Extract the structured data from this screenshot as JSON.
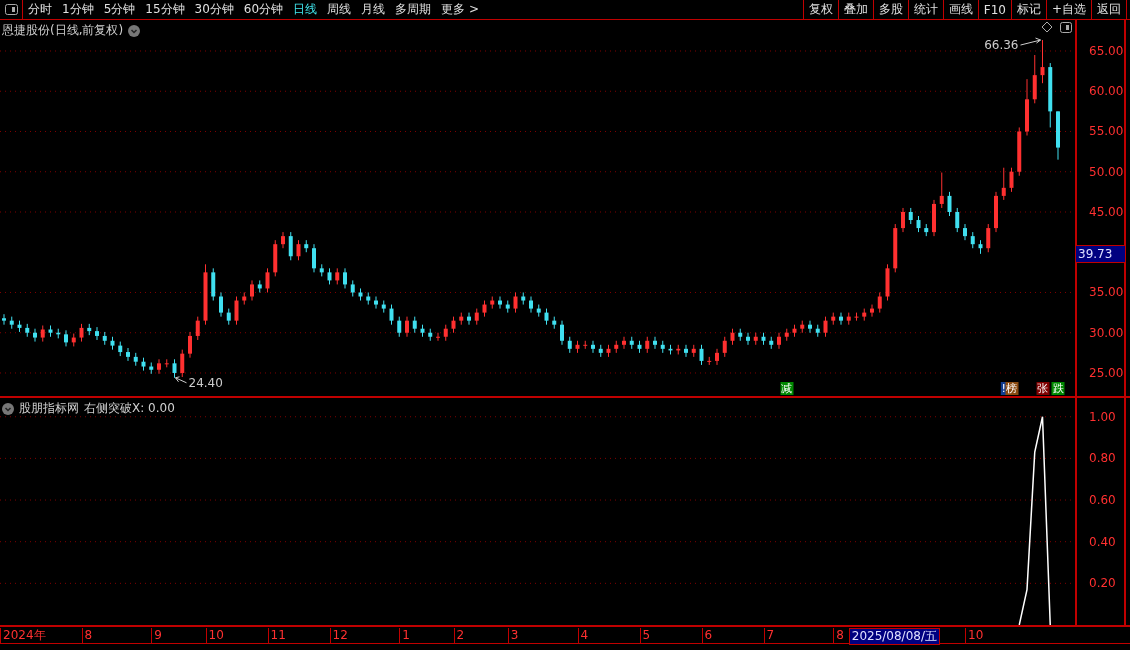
{
  "toolbar": {
    "periods": [
      {
        "label": "分时",
        "selected": false
      },
      {
        "label": "1分钟",
        "selected": false
      },
      {
        "label": "5分钟",
        "selected": false
      },
      {
        "label": "15分钟",
        "selected": false
      },
      {
        "label": "30分钟",
        "selected": false
      },
      {
        "label": "60分钟",
        "selected": false
      },
      {
        "label": "日线",
        "selected": true
      },
      {
        "label": "周线",
        "selected": false
      },
      {
        "label": "月线",
        "selected": false
      },
      {
        "label": "多周期",
        "selected": false
      },
      {
        "label": "更多 >",
        "selected": false
      }
    ],
    "buttons": [
      "复权",
      "叠加",
      "多股",
      "统计",
      "画线",
      "F10",
      "标记",
      "+自选",
      "返回"
    ]
  },
  "main_pane": {
    "title": "恩捷股份(日线,前复权)",
    "high_label": "66.36",
    "low_label": "24.40",
    "current_price": "39.73",
    "chart_data": {
      "type": "candlestick",
      "grid": true,
      "ylim": [
        22.14,
        68.85
      ],
      "yticks": [
        {
          "value": 25,
          "label": "25.00"
        },
        {
          "value": 30,
          "label": "30.00"
        },
        {
          "value": 35,
          "label": "35.00"
        },
        {
          "value": 45,
          "label": "45.00"
        },
        {
          "value": 50,
          "label": "50.00"
        },
        {
          "value": 55,
          "label": "55.00"
        },
        {
          "value": 60,
          "label": "60.00"
        },
        {
          "value": 65,
          "label": "65.00"
        }
      ],
      "ohlc": [
        [
          31.8,
          32.3,
          31,
          31.5
        ],
        [
          31.5,
          32,
          30.5,
          31
        ],
        [
          31,
          31.5,
          30.1,
          30.6
        ],
        [
          30.6,
          31.1,
          29.5,
          30
        ],
        [
          30,
          30.5,
          28.9,
          29.4
        ],
        [
          29.4,
          30.9,
          28.9,
          30.4
        ],
        [
          30.4,
          30.9,
          29.5,
          30
        ],
        [
          30,
          30.5,
          29.3,
          29.8
        ],
        [
          29.8,
          30.3,
          28.3,
          28.8
        ],
        [
          28.8,
          29.9,
          28.3,
          29.4
        ],
        [
          29.4,
          31.1,
          28.9,
          30.6
        ],
        [
          30.6,
          31.1,
          29.7,
          30.2
        ],
        [
          30.2,
          30.7,
          29.1,
          29.6
        ],
        [
          29.6,
          30.1,
          28.5,
          29
        ],
        [
          29,
          29.5,
          27.9,
          28.4
        ],
        [
          28.4,
          28.9,
          27.1,
          27.6
        ],
        [
          27.6,
          28.1,
          26.5,
          27
        ],
        [
          27,
          27.5,
          25.9,
          26.4
        ],
        [
          26.4,
          26.9,
          25.3,
          25.8
        ],
        [
          25.8,
          26.3,
          24.9,
          25.4
        ],
        [
          25.4,
          26.7,
          24.9,
          26.2
        ],
        [
          26.2,
          26.7,
          25.7,
          26.2
        ],
        [
          26.2,
          26.7,
          24.4,
          25
        ],
        [
          25,
          27.9,
          24.5,
          27.4
        ],
        [
          27.4,
          30.1,
          26.9,
          29.6
        ],
        [
          29.6,
          32,
          29.1,
          31.5
        ],
        [
          31.5,
          38.5,
          31,
          37.5
        ],
        [
          37.5,
          38,
          34,
          34.5
        ],
        [
          34.5,
          35,
          32,
          32.5
        ],
        [
          32.5,
          33,
          31,
          31.5
        ],
        [
          31.5,
          34.5,
          31,
          34
        ],
        [
          34,
          35,
          33.5,
          34.5
        ],
        [
          34.5,
          36.5,
          34,
          36
        ],
        [
          36,
          36.5,
          35,
          35.5
        ],
        [
          35.5,
          38,
          35,
          37.5
        ],
        [
          37.5,
          41.5,
          37,
          41
        ],
        [
          41,
          42.5,
          40.5,
          42
        ],
        [
          42,
          42.5,
          39,
          39.5
        ],
        [
          39.5,
          41.5,
          39,
          41
        ],
        [
          41,
          41.5,
          40,
          40.5
        ],
        [
          40.5,
          41,
          37.5,
          38
        ],
        [
          38,
          38.5,
          37,
          37.5
        ],
        [
          37.5,
          38,
          36,
          36.5
        ],
        [
          36.5,
          38,
          36,
          37.5
        ],
        [
          37.5,
          38,
          35.5,
          36
        ],
        [
          36,
          36.5,
          34.5,
          35
        ],
        [
          35,
          35.5,
          34,
          34.5
        ],
        [
          34.5,
          35,
          33.5,
          34
        ],
        [
          34,
          34.5,
          33,
          33.5
        ],
        [
          33.5,
          34,
          32.5,
          33
        ],
        [
          33,
          33.5,
          31,
          31.5
        ],
        [
          31.5,
          32,
          29.5,
          30
        ],
        [
          30,
          32,
          29.5,
          31.5
        ],
        [
          31.5,
          32,
          30,
          30.5
        ],
        [
          30.5,
          31,
          29.5,
          30
        ],
        [
          30,
          30.5,
          29,
          29.5
        ],
        [
          29.5,
          30,
          29,
          29.5
        ],
        [
          29.5,
          31,
          29,
          30.5
        ],
        [
          30.5,
          32,
          30,
          31.5
        ],
        [
          31.5,
          32.5,
          31,
          32
        ],
        [
          32,
          32.5,
          31,
          31.5
        ],
        [
          31.5,
          33,
          31,
          32.5
        ],
        [
          32.5,
          34,
          32,
          33.5
        ],
        [
          33.5,
          34.5,
          33,
          34
        ],
        [
          34,
          34.5,
          33,
          33.5
        ],
        [
          33.5,
          34,
          32.5,
          33
        ],
        [
          33,
          35,
          32.5,
          34.5
        ],
        [
          34.5,
          35,
          33.5,
          34
        ],
        [
          34,
          34.5,
          32.5,
          33
        ],
        [
          33,
          33.5,
          32,
          32.5
        ],
        [
          32.5,
          33,
          31,
          31.5
        ],
        [
          31.5,
          32,
          30.5,
          31
        ],
        [
          31,
          31.5,
          28.5,
          29
        ],
        [
          29,
          29.5,
          27.5,
          28
        ],
        [
          28,
          29,
          27.5,
          28.5
        ],
        [
          28.5,
          29,
          28,
          28.5
        ],
        [
          28.5,
          29,
          27.5,
          28
        ],
        [
          28,
          28.5,
          27,
          27.5
        ],
        [
          27.5,
          28.5,
          27,
          28
        ],
        [
          28,
          29,
          27.5,
          28.5
        ],
        [
          28.5,
          29.5,
          28,
          29
        ],
        [
          29,
          29.5,
          28,
          28.5
        ],
        [
          28.5,
          29,
          27.5,
          28
        ],
        [
          28,
          29.5,
          27.5,
          29
        ],
        [
          29,
          29.5,
          28,
          28.5
        ],
        [
          28.5,
          29,
          27.5,
          28
        ],
        [
          28,
          28.5,
          27.3,
          27.8
        ],
        [
          27.8,
          28.5,
          27.3,
          28
        ],
        [
          28,
          28.5,
          27,
          27.5
        ],
        [
          27.5,
          28.5,
          27,
          28
        ],
        [
          28,
          28.5,
          26,
          26.5
        ],
        [
          26.5,
          27,
          26,
          26.5
        ],
        [
          26.5,
          28,
          26,
          27.5
        ],
        [
          27.5,
          29.5,
          27,
          29
        ],
        [
          29,
          30.5,
          28.5,
          30
        ],
        [
          30,
          30.5,
          29,
          29.5
        ],
        [
          29.5,
          30,
          28.5,
          29
        ],
        [
          29,
          30,
          28.5,
          29.5
        ],
        [
          29.5,
          30,
          28.5,
          29
        ],
        [
          29,
          29.5,
          28,
          28.5
        ],
        [
          28.5,
          30,
          28,
          29.5
        ],
        [
          29.5,
          30.5,
          29,
          30
        ],
        [
          30,
          31,
          29.5,
          30.5
        ],
        [
          30.5,
          31.5,
          30,
          31
        ],
        [
          31,
          31.5,
          30,
          30.5
        ],
        [
          30.5,
          31,
          29.5,
          30
        ],
        [
          30,
          32,
          29.5,
          31.5
        ],
        [
          31.5,
          32.5,
          31,
          32
        ],
        [
          32,
          32.5,
          31,
          31.5
        ],
        [
          31.5,
          32.5,
          31,
          32
        ],
        [
          32,
          32.5,
          31.5,
          32
        ],
        [
          32,
          33,
          31.5,
          32.5
        ],
        [
          32.5,
          33.5,
          32,
          33
        ],
        [
          33,
          35,
          32.5,
          34.5
        ],
        [
          34.5,
          38.5,
          34,
          38
        ],
        [
          38,
          43.5,
          37.5,
          43
        ],
        [
          43,
          45.5,
          42.5,
          45
        ],
        [
          45,
          45.5,
          43.5,
          44
        ],
        [
          44,
          44.5,
          42.5,
          43
        ],
        [
          43,
          43.5,
          42,
          42.5
        ],
        [
          42.5,
          46.5,
          42,
          46
        ],
        [
          46,
          49.9,
          45.5,
          47
        ],
        [
          47,
          47.5,
          44.5,
          45
        ],
        [
          45,
          45.5,
          42.5,
          43
        ],
        [
          43,
          43.5,
          41.5,
          42
        ],
        [
          42,
          42.5,
          40.5,
          41
        ],
        [
          41,
          41.5,
          39.8,
          40.5
        ],
        [
          40.5,
          43.5,
          40,
          43
        ],
        [
          43,
          47.5,
          42.5,
          47
        ],
        [
          47,
          50.5,
          46.5,
          48
        ],
        [
          48,
          50.5,
          47.5,
          50
        ],
        [
          50,
          55.5,
          49.5,
          55
        ],
        [
          55,
          61.5,
          54.5,
          59
        ],
        [
          59,
          64.5,
          58.5,
          62
        ],
        [
          62,
          66.36,
          61,
          63
        ],
        [
          63,
          63.5,
          55.5,
          57.5
        ],
        [
          57.5,
          57.5,
          51.5,
          53
        ]
      ]
    },
    "markers": [
      {
        "text": "减",
        "color": "#008800"
      },
      {
        "text": "!",
        "color": "#103c90"
      },
      {
        "text": "榜",
        "color": "#8a4a10"
      },
      {
        "text": "张",
        "color": "#800000"
      },
      {
        "text": "跌",
        "color": "#008800"
      }
    ]
  },
  "indicator_pane": {
    "name": "股朋指标网",
    "reading": "右侧突破X: 0.00",
    "chart_data": {
      "type": "line",
      "grid": true,
      "ylim": [
        0,
        1.09
      ],
      "yticks": [
        {
          "value": 0.2,
          "label": "0.20"
        },
        {
          "value": 0.4,
          "label": "0.40"
        },
        {
          "value": 0.6,
          "label": "0.60"
        },
        {
          "value": 0.8,
          "label": "0.80"
        },
        {
          "value": 1,
          "label": "1.00"
        }
      ],
      "categories": [
        null,
        null,
        null,
        null,
        null,
        null,
        null,
        null,
        null,
        null,
        null,
        null,
        null,
        null,
        null,
        null,
        null,
        null,
        null,
        null,
        null,
        null,
        null,
        null,
        null,
        null,
        null,
        null,
        null,
        null,
        null,
        null,
        null,
        null,
        null,
        null,
        null,
        null,
        null,
        null,
        null,
        null,
        null,
        null,
        null,
        null,
        null,
        null,
        null,
        null,
        null,
        null,
        null,
        null,
        null,
        null,
        null,
        null,
        null,
        null,
        null,
        null,
        null,
        null,
        null,
        null,
        null,
        null,
        null,
        null,
        null,
        null,
        null,
        null,
        null,
        null,
        null,
        null,
        null,
        null,
        null,
        null,
        null,
        null,
        null,
        null,
        null,
        null,
        null,
        null,
        null,
        null,
        null,
        null,
        null,
        null,
        null,
        null,
        null,
        null,
        null,
        null,
        null,
        null,
        null,
        null,
        null,
        null,
        null,
        null,
        null,
        null,
        null,
        null,
        null,
        null,
        null,
        null,
        null,
        null,
        null,
        null,
        null,
        null,
        null,
        null,
        null,
        null,
        null,
        null,
        null,
        null,
        null,
        null,
        null,
        null,
        null
      ],
      "values": [
        null,
        null,
        null,
        null,
        null,
        null,
        null,
        null,
        null,
        null,
        null,
        null,
        null,
        null,
        null,
        null,
        null,
        null,
        null,
        null,
        null,
        null,
        null,
        null,
        null,
        null,
        null,
        null,
        null,
        null,
        null,
        null,
        null,
        null,
        null,
        null,
        null,
        null,
        null,
        null,
        null,
        null,
        null,
        null,
        null,
        null,
        null,
        null,
        null,
        null,
        null,
        null,
        null,
        null,
        null,
        null,
        null,
        null,
        null,
        null,
        null,
        null,
        null,
        null,
        null,
        null,
        null,
        null,
        null,
        null,
        null,
        null,
        null,
        null,
        null,
        null,
        null,
        null,
        null,
        null,
        null,
        null,
        null,
        null,
        null,
        null,
        null,
        null,
        null,
        null,
        null,
        null,
        null,
        null,
        null,
        null,
        null,
        null,
        null,
        null,
        null,
        null,
        null,
        null,
        null,
        null,
        null,
        null,
        null,
        null,
        null,
        null,
        null,
        null,
        null,
        null,
        null,
        null,
        null,
        null,
        null,
        null,
        null,
        null,
        null,
        null,
        null,
        null,
        null,
        null,
        null,
        0,
        0.17,
        0.83,
        1,
        0,
        null
      ]
    }
  },
  "date_axis": [
    {
      "label": "2024年",
      "selected": false
    },
    {
      "label": "8",
      "selected": false
    },
    {
      "label": "9",
      "selected": false
    },
    {
      "label": "10",
      "selected": false
    },
    {
      "label": "11",
      "selected": false
    },
    {
      "label": "12",
      "selected": false
    },
    {
      "label": "1",
      "selected": false
    },
    {
      "label": "2",
      "selected": false
    },
    {
      "label": "3",
      "selected": false
    },
    {
      "label": "4",
      "selected": false
    },
    {
      "label": "5",
      "selected": false
    },
    {
      "label": "6",
      "selected": false
    },
    {
      "label": "7",
      "selected": false
    },
    {
      "label": "8",
      "selected": false
    },
    {
      "label": "2025/08/08/五",
      "selected": true
    },
    {
      "label": "10",
      "selected": false
    }
  ]
}
